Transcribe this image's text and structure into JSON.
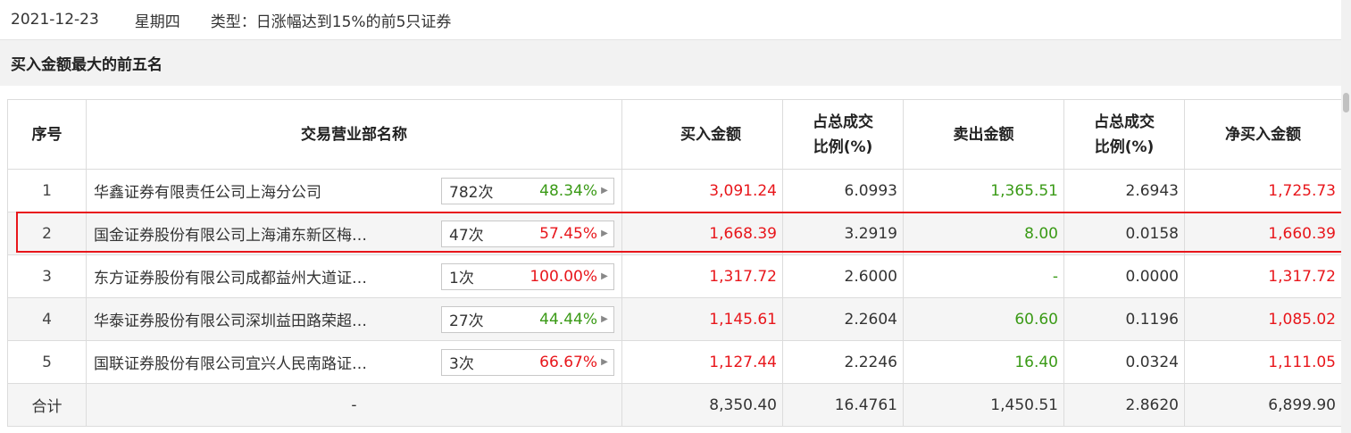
{
  "info": {
    "date": "2021-12-23",
    "weekday": "星期四",
    "type_text": "类型：日涨幅达到15%的前5只证券"
  },
  "section": {
    "title": "买入金额最大的前五名"
  },
  "table": {
    "headers": {
      "rank": "序号",
      "dept": "交易营业部名称",
      "buy": "买入金额",
      "buy_ratio_line1": "占总成交",
      "buy_ratio_line2": "比例(%)",
      "sell": "卖出金额",
      "sell_ratio_line1": "占总成交",
      "sell_ratio_line2": "比例(%)",
      "net": "净买入金额"
    },
    "rows": [
      {
        "rank": "1",
        "dept": "华鑫证券有限责任公司上海分公司",
        "count": "782次",
        "pct": "48.34%",
        "pct_color": "green",
        "buy": "3,091.24",
        "buy_ratio": "6.0993",
        "sell": "1,365.51",
        "sell_ratio": "2.6943",
        "net": "1,725.73"
      },
      {
        "rank": "2",
        "dept": "国金证券股份有限公司上海浦东新区梅…",
        "count": "47次",
        "pct": "57.45%",
        "pct_color": "red",
        "buy": "1,668.39",
        "buy_ratio": "3.2919",
        "sell": "8.00",
        "sell_ratio": "0.0158",
        "net": "1,660.39"
      },
      {
        "rank": "3",
        "dept": "东方证券股份有限公司成都益州大道证…",
        "count": "1次",
        "pct": "100.00%",
        "pct_color": "red",
        "buy": "1,317.72",
        "buy_ratio": "2.6000",
        "sell": "-",
        "sell_ratio": "0.0000",
        "net": "1,317.72"
      },
      {
        "rank": "4",
        "dept": "华泰证券股份有限公司深圳益田路荣超…",
        "count": "27次",
        "pct": "44.44%",
        "pct_color": "green",
        "buy": "1,145.61",
        "buy_ratio": "2.2604",
        "sell": "60.60",
        "sell_ratio": "0.1196",
        "net": "1,085.02"
      },
      {
        "rank": "5",
        "dept": "国联证券股份有限公司宜兴人民南路证…",
        "count": "3次",
        "pct": "66.67%",
        "pct_color": "red",
        "buy": "1,127.44",
        "buy_ratio": "2.2246",
        "sell": "16.40",
        "sell_ratio": "0.0324",
        "net": "1,111.05"
      }
    ],
    "total": {
      "label": "合计",
      "dept": "-",
      "buy": "8,350.40",
      "buy_ratio": "16.4761",
      "sell": "1,450.51",
      "sell_ratio": "2.8620",
      "net": "6,899.90"
    }
  },
  "colors": {
    "up": "#e8161b",
    "down": "#3a9a16",
    "highlight": "#e8161b"
  }
}
